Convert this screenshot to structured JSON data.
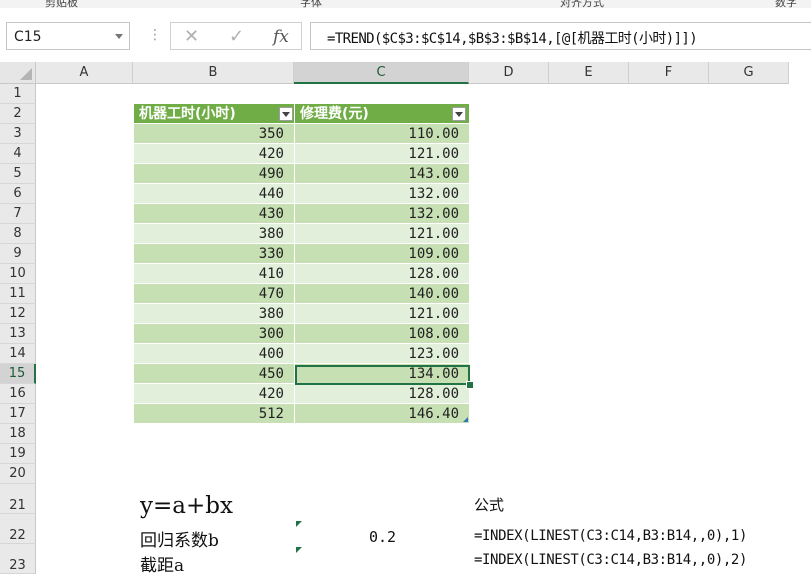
{
  "ribbon": {
    "groups": [
      "剪贴板",
      "字体",
      "对齐方式",
      "数字"
    ]
  },
  "formula_bar": {
    "name_box": "C15",
    "cancel_icon": "cancel-x-icon",
    "enter_icon": "checkmark-icon",
    "function_label": "fx",
    "formula": "=TREND($C$3:$C$14,$B$3:$B$14,[@[机器工时(小时)]])"
  },
  "sheet": {
    "columns": [
      "A",
      "B",
      "C",
      "D",
      "E",
      "F",
      "G"
    ],
    "active_column": "C",
    "rows": [
      "1",
      "2",
      "3",
      "4",
      "5",
      "6",
      "7",
      "8",
      "9",
      "10",
      "11",
      "12",
      "13",
      "14",
      "15",
      "16",
      "17",
      "18",
      "19",
      "20",
      "21",
      "22",
      "23"
    ],
    "active_row": "15",
    "table": {
      "headers": [
        "机器工时(小时)",
        "修理费(元)"
      ],
      "rows": [
        [
          "350",
          "110.00"
        ],
        [
          "420",
          "121.00"
        ],
        [
          "490",
          "143.00"
        ],
        [
          "440",
          "132.00"
        ],
        [
          "430",
          "132.00"
        ],
        [
          "380",
          "121.00"
        ],
        [
          "330",
          "109.00"
        ],
        [
          "410",
          "128.00"
        ],
        [
          "470",
          "140.00"
        ],
        [
          "380",
          "121.00"
        ],
        [
          "300",
          "108.00"
        ],
        [
          "400",
          "123.00"
        ],
        [
          "450",
          "134.00"
        ],
        [
          "420",
          "128.00"
        ],
        [
          "512",
          "146.40"
        ]
      ]
    },
    "lower": {
      "equation": "y=a+bx",
      "formula_heading": "公式",
      "coef_label": "回归系数b",
      "coef_value": "0.2",
      "coef_formula": "=INDEX(LINEST(C3:C14,B3:B14,,0),1)",
      "intercept_label": "截距a",
      "intercept_formula": "=INDEX(LINEST(C3:C14,B3:B14,,0),2)"
    }
  },
  "colors": {
    "header_green": "#70ad47",
    "band_dark": "#c6e0b4",
    "band_light": "#e2efda",
    "selection": "#217346"
  }
}
